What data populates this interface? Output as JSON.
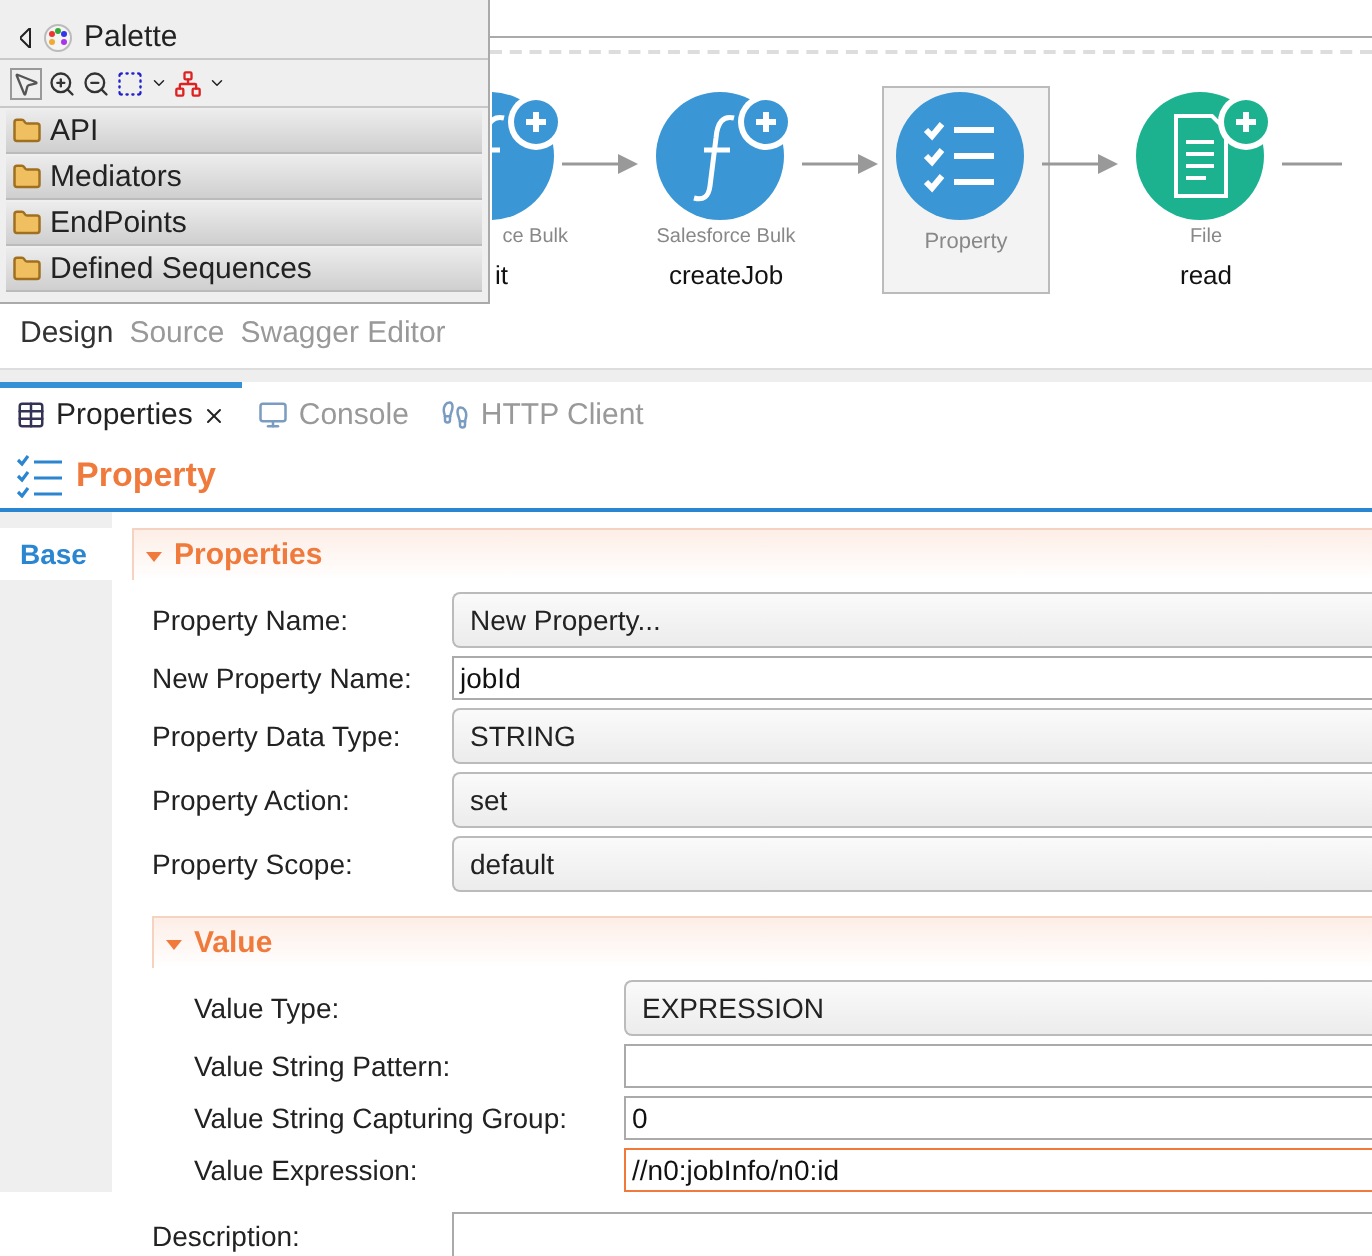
{
  "palette": {
    "title": "Palette",
    "drawers": [
      "API",
      "Mediators",
      "EndPoints",
      "Defined Sequences"
    ]
  },
  "canvas": {
    "nodes": [
      {
        "kind": "connector",
        "caption": "ce Bulk",
        "name": "it",
        "selected": false
      },
      {
        "kind": "function",
        "caption": "Salesforce Bulk",
        "name": "createJob",
        "selected": false
      },
      {
        "kind": "property",
        "caption": "Property",
        "selected": true
      },
      {
        "kind": "file",
        "caption": "File",
        "name": "read",
        "selected": false
      }
    ]
  },
  "editor_tabs": [
    {
      "label": "Design",
      "selected": true
    },
    {
      "label": "Source",
      "selected": false
    },
    {
      "label": "Swagger Editor",
      "selected": false
    }
  ],
  "views": [
    {
      "label": "Properties",
      "selected": true,
      "kind": "properties"
    },
    {
      "label": "Console",
      "selected": false,
      "kind": "console"
    },
    {
      "label": "HTTP Client",
      "selected": false,
      "kind": "http"
    }
  ],
  "header": {
    "title": "Property"
  },
  "side_tabs": [
    {
      "label": "Base",
      "selected": true
    }
  ],
  "section": {
    "title": "Properties",
    "expanded": true,
    "rows": [
      {
        "label": "Property Name:",
        "kind": "combo",
        "value": "New Property..."
      },
      {
        "label": "New Property Name:",
        "kind": "text",
        "value": "jobId"
      },
      {
        "label": "Property Data Type:",
        "kind": "combo",
        "value": "STRING"
      },
      {
        "label": "Property Action:",
        "kind": "combo",
        "value": "set"
      },
      {
        "label": "Property Scope:",
        "kind": "combo",
        "value": "default"
      }
    ]
  },
  "subsection": {
    "title": "Value",
    "expanded": true,
    "rows": [
      {
        "label": "Value Type:",
        "kind": "combo",
        "value": "EXPRESSION"
      },
      {
        "label": "Value String Pattern:",
        "kind": "text"
      },
      {
        "label": "Value String Capturing Group:",
        "kind": "text",
        "value": "0"
      },
      {
        "label": "Value Expression:",
        "kind": "text",
        "value": "//n0:jobInfo/n0:id",
        "focused": true
      }
    ]
  },
  "description": {
    "label": "Description:"
  }
}
